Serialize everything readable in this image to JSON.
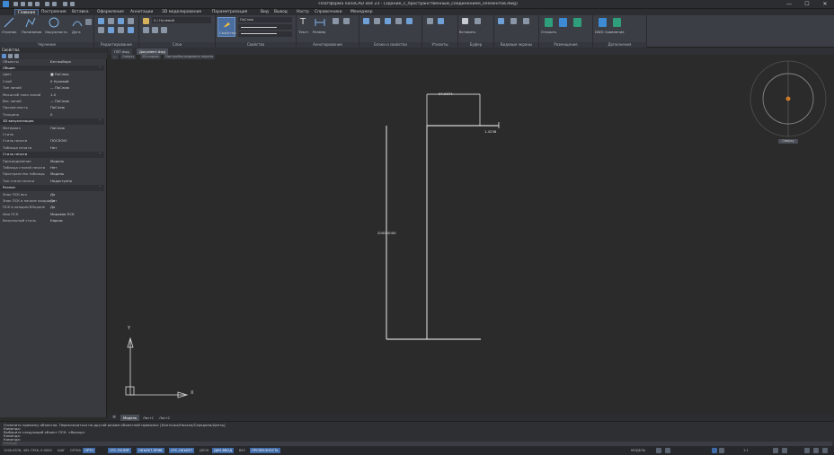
{
  "window": {
    "title": "Платформа nanoCAD x64 23 - [Здание_с_пространственным_соединением_элементов.dwg]",
    "min_label": "—",
    "max_label": "☐",
    "close_label": "✕"
  },
  "menu_tabs": [
    "Главная",
    "Построение",
    "Вставка",
    "Оформление",
    "Аннотации",
    "3D моделирование",
    "Параметризация",
    "Вид",
    "Вывод",
    "Настр",
    "Справочники",
    "Менеджер"
  ],
  "ribbon": {
    "panels": [
      "Черчение",
      "Редактирование",
      "Слои",
      "Свойства",
      "Аннотирование",
      "Блоки и свойства",
      "Утилиты",
      "Буфер",
      "Видовые экраны",
      "Размещение",
      "Дополнения"
    ],
    "layer_value": "0 / Нулевой",
    "line_value": "ПоСлою",
    "draw_labels": [
      "Отрезок",
      "Полилиния",
      "Окружность",
      "Дуга"
    ],
    "prop_label": "Свойства",
    "annot_labels": [
      "Текст",
      "Размер"
    ],
    "clip_labels": [
      "Вставить",
      "Копировать"
    ],
    "extra_labels": [
      "Открыть",
      "Пакетная печать",
      "DWG Сравнение",
      "Редактирование"
    ]
  },
  "doc_tabs": [
    "ПЗТ.dwg",
    "Документ.dwg"
  ],
  "view_controls": [
    "—",
    "Сверху",
    "2D-каркас",
    "Настройка видового экрана"
  ],
  "properties": {
    "title": "Свойства",
    "selector": "Объекты",
    "selector_value": "Без выбора",
    "rows": [
      {
        "k": "Общие",
        "v": "",
        "sec": true
      },
      {
        "k": "Цвет",
        "v": "■ ПоСлою",
        "sec": false
      },
      {
        "k": "Слой",
        "v": "0 Нулевой",
        "sec": false
      },
      {
        "k": "Тип линий",
        "v": "— ПоСлою",
        "sec": false
      },
      {
        "k": "Масштаб типа линий",
        "v": "1.0",
        "sec": false
      },
      {
        "k": "Вес линий",
        "v": "— ПоСлою",
        "sec": false
      },
      {
        "k": "Прозрачность",
        "v": "ПоСлою",
        "sec": false
      },
      {
        "k": "Толщина",
        "v": "0",
        "sec": false
      },
      {
        "k": "3D визуализация",
        "v": "",
        "sec": true
      },
      {
        "k": "Материал",
        "v": "ПоСлою",
        "sec": false
      },
      {
        "k": "Стиль",
        "v": "",
        "sec": false
      },
      {
        "k": "Стиль печати",
        "v": "ПОСЛОЮ",
        "sec": false
      },
      {
        "k": "Таблица печати",
        "v": "Нет",
        "sec": false
      },
      {
        "k": "Стиль печати",
        "v": "",
        "sec": true
      },
      {
        "k": "Присоединение",
        "v": "Модель",
        "sec": false
      },
      {
        "k": "Таблица стилей печати",
        "v": "Нет",
        "sec": false
      },
      {
        "k": "Пространство таблицы",
        "v": "Модель",
        "sec": false
      },
      {
        "k": "Тип стиля печати",
        "v": "Недоступно",
        "sec": false
      },
      {
        "k": "Разное",
        "v": "",
        "sec": true
      },
      {
        "k": "Знак ПСК вкл",
        "v": "Да",
        "sec": false
      },
      {
        "k": "Знак ПСК в начале координат",
        "v": "Да",
        "sec": false
      },
      {
        "k": "ПСК в каждом ВЭкране",
        "v": "Да",
        "sec": false
      },
      {
        "k": "Имя ПСК",
        "v": "Мировая ПСК",
        "sec": false
      },
      {
        "k": "Визуальный стиль",
        "v": "Каркас",
        "sec": false
      }
    ]
  },
  "drawing": {
    "dim_top": "97.9974",
    "dim_right": "1.4236",
    "dim_left": "2000.0000",
    "compass_label": "Сверху",
    "ucs_x": "X",
    "ucs_y": "Y"
  },
  "layout_tabs": [
    "Модель",
    "Лист1",
    "Лист2"
  ],
  "command_lines": [
    "Отменить привязку объектов. Переключиться на другой режим объектной привязки: [Конточка/Начало/Середина/Центр]",
    "Команда:",
    "Выберите следующий объект ПСК: <Выход>",
    "Команда:",
    "Команда:"
  ],
  "command_placeholder": "Команда:",
  "status_left": [
    {
      "label": "1000.6578, 405.7356, 0.0000",
      "on": false
    },
    {
      "label": "ШАГ",
      "on": false
    },
    {
      "label": "СЕТКА",
      "on": false
    },
    {
      "label": "ОРТО",
      "on": true
    },
    {
      "label": "ОТС-ПОЛЯР",
      "on": true
    },
    {
      "label": "ОБЪЕКТ-ПРИВ",
      "on": true
    },
    {
      "label": "ОТС-ОБЪЕКТ",
      "on": true
    },
    {
      "label": "ДПСК",
      "on": false
    },
    {
      "label": "ДИН-ВВОД",
      "on": true
    },
    {
      "label": "ВЕС",
      "on": false
    },
    {
      "label": "ПРОЗРАЧНОСТЬ",
      "on": true
    }
  ],
  "status_right": [
    "МОДЕЛЬ",
    "1:1",
    "Аннотирование"
  ],
  "colors": {
    "accent": "#3e6aa8",
    "canvas": "#2b2b2b",
    "line": "#ffffff",
    "compass": "#c87a2a"
  }
}
